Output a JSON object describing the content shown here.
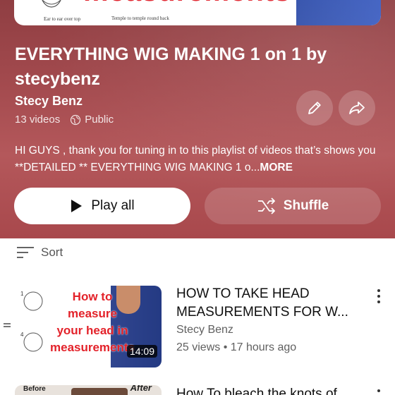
{
  "cover": {
    "title_text": "measurements",
    "label_left": "Ear to ear over top",
    "label_right": "Temple to temple round back"
  },
  "playlist": {
    "title": "EVERYTHING WIG MAKING 1 on 1 by stecybenz",
    "owner": "Stecy Benz",
    "video_count": "13 videos",
    "visibility": "Public",
    "description": "HI GUYS , thank you for tuning in to this playlist of videos that’s shows you **DETAILED ** EVERYTHING WIG MAKING 1 o...",
    "more_label": "MORE"
  },
  "actions": {
    "play_all": "Play all",
    "shuffle": "Shuffle",
    "edit_icon": "pencil-icon",
    "share_icon": "share-arrow-icon"
  },
  "sort": {
    "label": "Sort"
  },
  "videos": [
    {
      "thumb_text": "How to measure your head in measurements",
      "thumb_lines": [
        "How to",
        "measure",
        "your head in",
        "measurements"
      ],
      "duration": "14:09",
      "title": "HOW TO TAKE HEAD MEASUREMENTS FOR W...",
      "channel": "Stecy Benz",
      "meta": "25 views • 17 hours ago"
    },
    {
      "thumb_before": "Before",
      "thumb_after": "After",
      "title": "How To bleach the knots of"
    }
  ],
  "colors": {
    "hero_top": "#8f3e42",
    "hero_bottom": "#a8484c",
    "thumb_text": "#e3222a"
  }
}
